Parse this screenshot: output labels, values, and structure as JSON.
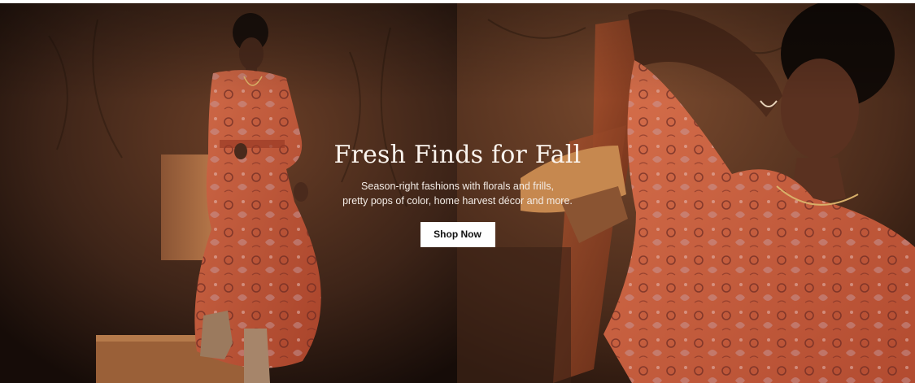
{
  "hero": {
    "title": "Fresh Finds for Fall",
    "subtitle_line1": "Season-right fashions with florals and frills,",
    "subtitle_line2": "pretty pops of color, home harvest décor and more.",
    "cta_label": "Shop Now",
    "colors": {
      "backdrop": "#3a2216",
      "dress": "#c65a3a",
      "button_bg": "#ffffff",
      "button_text": "#111111"
    }
  }
}
